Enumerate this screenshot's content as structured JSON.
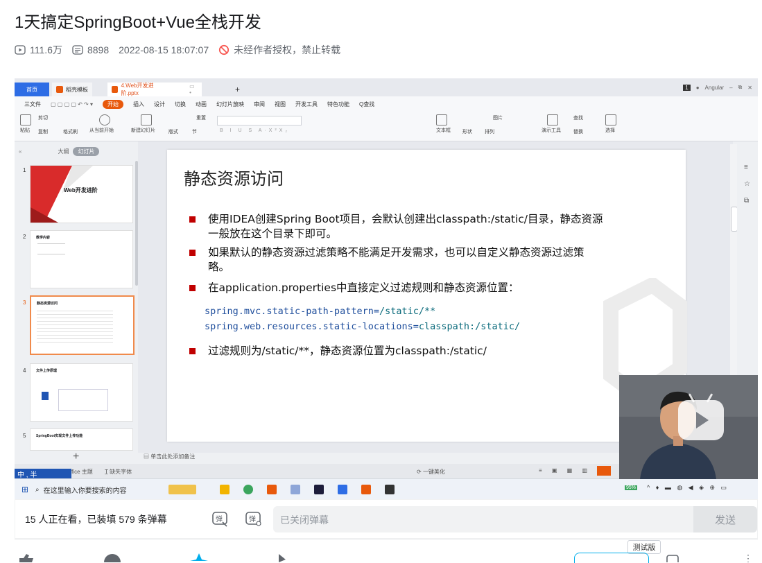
{
  "video": {
    "title": "1天搞定SpringBoot+Vue全栈开发",
    "views": "111.6万",
    "danmaku_count": "8898",
    "date": "2022-08-15 18:07:07",
    "copyright": "未经作者授权，禁止转载"
  },
  "wps": {
    "home_tab": "首页",
    "template_tab": "稻壳模板",
    "file_tab": "4.Web开发进阶.pptx",
    "account": "Angular",
    "menu": [
      "三文件",
      "开始",
      "插入",
      "设计",
      "切换",
      "动画",
      "幻灯片放映",
      "审阅",
      "视图",
      "开发工具",
      "特色功能",
      "Q查找"
    ],
    "ribbon": {
      "paste": "粘贴",
      "cut": "剪切",
      "copy": "复制",
      "format": "格式刷",
      "from_current": "从当前开始",
      "new_slide": "新建幻灯片",
      "layout": "版式",
      "section": "节",
      "reset": "重置",
      "textbox": "文本框",
      "shape": "形状",
      "arrange": "排列",
      "picture": "图片",
      "present_tools": "演示工具",
      "find": "查找",
      "replace": "替换",
      "select": "选择"
    },
    "panel_outline": "大纲",
    "panel_slides": "幻灯片",
    "thumbs": [
      {
        "num": "1",
        "title": "Web开发进阶"
      },
      {
        "num": "2",
        "title": "教学内容"
      },
      {
        "num": "3",
        "title": "静态资源访问"
      },
      {
        "num": "4",
        "title": "文件上传原理"
      },
      {
        "num": "5",
        "title": "SpringBoot实现文件上传功能"
      }
    ],
    "notes_placeholder": "单击此处添加备注",
    "status_theme": "ffice 主题",
    "status_font": "缺失字体",
    "status_beautify": "一键美化",
    "battery": "95%",
    "taskbar_search": "在这里输入你要搜索的内容",
    "ime": "中 , 半"
  },
  "slide": {
    "title": "静态资源访问",
    "bullets": [
      "使用IDEA创建Spring Boot项目，会默认创建出classpath:/static/目录，静态资源一般放在这个目录下即可。",
      "如果默认的静态资源过滤策略不能满足开发需求，也可以自定义静态资源过滤策略。",
      "在application.properties中直接定义过滤规则和静态资源位置："
    ],
    "code": [
      {
        "key": "spring.mvc.static-path-pattern",
        "eq": "=",
        "val": "/static/**"
      },
      {
        "key": "spring.web.resources.static-locations",
        "eq": "=",
        "val": "classpath:/static/"
      }
    ],
    "last_bullet": "过滤规则为/static/**，静态资源位置为classpath:/static/"
  },
  "danmaku": {
    "viewers": "15 人正在看，已装填 579 条弹幕",
    "placeholder": "已关闭弹幕",
    "send": "发送",
    "test_tag": "测试版"
  },
  "colors": {
    "accent": "#e8590c",
    "wps_blue": "#2e6de5",
    "slide_bullet": "#c00000",
    "bili_blue": "#00aeec"
  }
}
